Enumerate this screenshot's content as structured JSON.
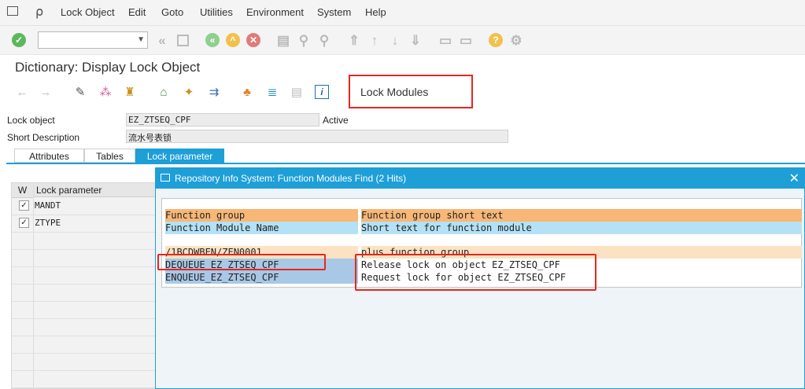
{
  "menubar": {
    "items": [
      "Lock Object",
      "Edit",
      "Goto",
      "Utilities",
      "Environment",
      "System",
      "Help"
    ]
  },
  "toolbar": {
    "command_field_value": "",
    "icons": [
      "enter-icon",
      "back-icon",
      "save-icon",
      "green-back-icon",
      "exit-icon",
      "cancel-icon",
      "print-icon",
      "find-icon",
      "find-next-icon",
      "first-page-icon",
      "prev-page-icon",
      "next-page-icon",
      "last-page-icon",
      "new-session-icon",
      "shortcut-icon",
      "help-icon",
      "settings-icon"
    ]
  },
  "page": {
    "title": "Dictionary: Display Lock Object"
  },
  "app_toolbar": {
    "lock_modules_label": "Lock Modules"
  },
  "form": {
    "lock_object_label": "Lock object",
    "lock_object_value": "EZ_ZTSEQ_CPF",
    "status": "Active",
    "short_description_label": "Short Description",
    "short_description_value": "流水号表锁"
  },
  "tabs": [
    "Attributes",
    "Tables",
    "Lock parameter"
  ],
  "lock_table": {
    "col_w": "W",
    "col_param": "Lock parameter",
    "rows": [
      {
        "checked": "✓",
        "value": "MANDT"
      },
      {
        "checked": "✓",
        "value": "ZTYPE"
      }
    ]
  },
  "dialog": {
    "title": "Repository Info System: Function Modules Find (2 Hits)",
    "close": "✕",
    "header1": {
      "col1": "Function group",
      "col2": "Function group short text"
    },
    "header2": {
      "col1": "Function Module Name",
      "col2": "Short text for function module"
    },
    "group_row": {
      "col1": "/1BCDWBEN/ZEN0001",
      "col2": "plus function group"
    },
    "rows": [
      {
        "col1": "DEQUEUE_EZ_ZTSEQ_CPF",
        "col2": "Release lock on object EZ_ZTSEQ_CPF"
      },
      {
        "col1": "ENQUEUE_EZ_ZTSEQ_CPF",
        "col2": "Request lock for object EZ_ZTSEQ_CPF"
      }
    ]
  }
}
